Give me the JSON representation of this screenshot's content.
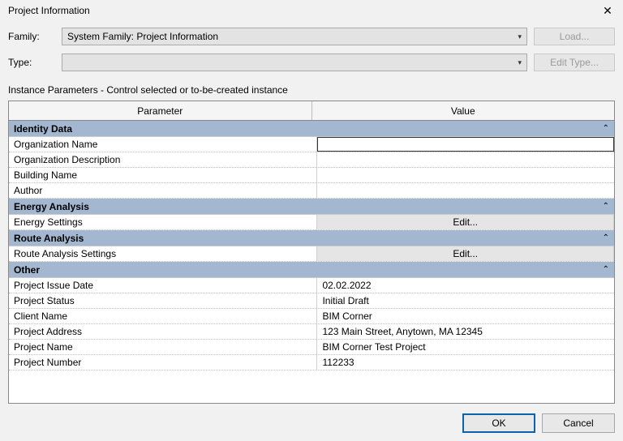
{
  "dialog": {
    "title": "Project Information",
    "family_label": "Family:",
    "family_value": "System Family: Project Information",
    "type_label": "Type:",
    "type_value": "",
    "load_btn": "Load...",
    "edit_type_btn": "Edit Type...",
    "instance_label": "Instance Parameters - Control selected or to-be-created instance"
  },
  "table": {
    "col_param": "Parameter",
    "col_value": "Value"
  },
  "groups": {
    "identity": {
      "title": "Identity Data",
      "rows": {
        "org_name": {
          "label": "Organization Name",
          "value": ""
        },
        "org_desc": {
          "label": "Organization Description",
          "value": ""
        },
        "building": {
          "label": "Building Name",
          "value": ""
        },
        "author": {
          "label": "Author",
          "value": ""
        }
      }
    },
    "energy": {
      "title": "Energy Analysis",
      "rows": {
        "settings": {
          "label": "Energy Settings",
          "value": "Edit..."
        }
      }
    },
    "route": {
      "title": "Route Analysis",
      "rows": {
        "settings": {
          "label": "Route Analysis Settings",
          "value": "Edit..."
        }
      }
    },
    "other": {
      "title": "Other",
      "rows": {
        "issue_date": {
          "label": "Project Issue Date",
          "value": "02.02.2022"
        },
        "status": {
          "label": "Project Status",
          "value": "Initial Draft"
        },
        "client": {
          "label": "Client Name",
          "value": "BIM Corner"
        },
        "address": {
          "label": "Project Address",
          "value": "123 Main Street, Anytown, MA 12345"
        },
        "pname": {
          "label": "Project Name",
          "value": "BIM Corner Test Project"
        },
        "pnum": {
          "label": "Project Number",
          "value": "112233"
        }
      }
    }
  },
  "footer": {
    "ok": "OK",
    "cancel": "Cancel"
  }
}
